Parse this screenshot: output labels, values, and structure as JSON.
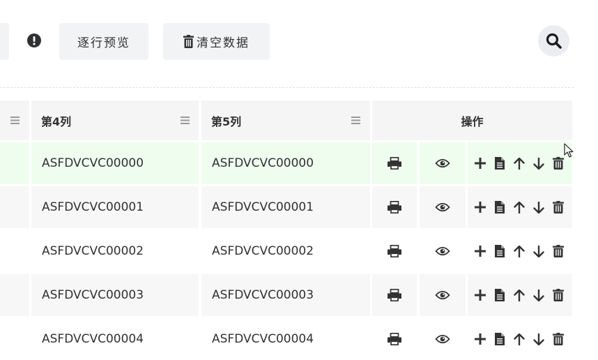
{
  "toolbar": {
    "preview_label": "逐行预览",
    "clear_label": "清空数据",
    "info_icon": "exclamation-circle-icon",
    "search_icon": "search-icon"
  },
  "table": {
    "headers": {
      "col3": "",
      "col4": "第4列",
      "col5": "第5列",
      "actions": "操作"
    },
    "rows": [
      {
        "c4": "ASFDVCVC00000",
        "c5": "ASFDVCVC00000"
      },
      {
        "c4": "ASFDVCVC00001",
        "c5": "ASFDVCVC00001"
      },
      {
        "c4": "ASFDVCVC00002",
        "c5": "ASFDVCVC00002"
      },
      {
        "c4": "ASFDVCVC00003",
        "c5": "ASFDVCVC00003"
      },
      {
        "c4": "ASFDVCVC00004",
        "c5": "ASFDVCVC00004"
      }
    ],
    "highlight_row": 0,
    "row_icons": [
      "print-icon",
      "eye-icon",
      "plus-icon",
      "file-icon",
      "arrow-up-icon",
      "arrow-down-icon",
      "trash-icon"
    ]
  },
  "colors": {
    "header_bg": "#f5f5f5",
    "row_highlight": "#effdef",
    "row_alt": "#f7f7f7",
    "button_bg": "#f2f3f5"
  }
}
